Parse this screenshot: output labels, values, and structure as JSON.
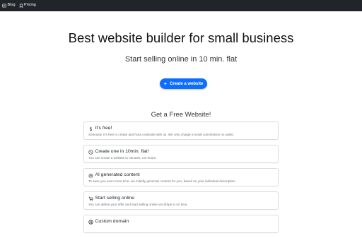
{
  "nav": {
    "items": [
      {
        "label": "Blog",
        "icon": "blog-icon"
      },
      {
        "label": "Pricing",
        "icon": "pricing-tag-icon"
      }
    ]
  },
  "hero": {
    "title": "Best website builder for small business",
    "subtitle": "Start selling online in 10 min. flat",
    "cta_label": "Create a website",
    "cta_icon": "plus-icon"
  },
  "features": {
    "title": "Get a Free Website!",
    "items": [
      {
        "icon": "dollar-icon",
        "title": "It's free!",
        "text": "Seriously. It's free to create and host a website with us. We only charge a small commission on sales."
      },
      {
        "icon": "clock-icon",
        "title": "Create one in 10min. flat!",
        "text": "You can create a website in minutes, not hours."
      },
      {
        "icon": "robot-icon",
        "title": "AI generated content",
        "text": "To save you even more time, we initially generate content for you, based on your individual description."
      },
      {
        "icon": "cart-icon",
        "title": "Start selling online",
        "text": "You can define your offer and start selling online via Stripe in no time."
      },
      {
        "icon": "globe-icon",
        "title": "Custom domain",
        "text": ""
      }
    ]
  },
  "colors": {
    "navbar": "#212529",
    "accent": "#0d6efd",
    "card_border": "#dcdcdc",
    "muted_text": "#6c757d"
  }
}
